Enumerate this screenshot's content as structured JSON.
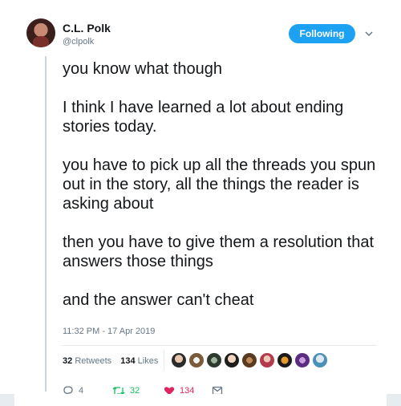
{
  "author": {
    "display_name": "C.L. Polk",
    "handle": "@clpolk"
  },
  "follow_button": {
    "label": "Following"
  },
  "tweet": {
    "paragraphs": [
      "you know what though",
      "I think I have learned a lot about ending stories today.",
      "you have to pick up all the threads you spun out in the story, all the things the reader is asking about",
      "then you have to give them a resolution that answers those things",
      "and the answer can't cheat"
    ],
    "timestamp": "11:32 PM - 17 Apr 2019"
  },
  "stats": {
    "retweets_count": "32",
    "retweets_label": "Retweets",
    "likes_count": "134",
    "likes_label": "Likes"
  },
  "actions": {
    "reply_count": "4",
    "retweet_count": "32",
    "like_count": "134"
  },
  "colors": {
    "accent": "#1da1f2",
    "retweet": "#17bf63",
    "like": "#e0245e",
    "muted": "#657786"
  },
  "icons": [
    "chevron-down-icon",
    "reply-icon",
    "retweet-icon",
    "heart-icon",
    "message-icon"
  ]
}
